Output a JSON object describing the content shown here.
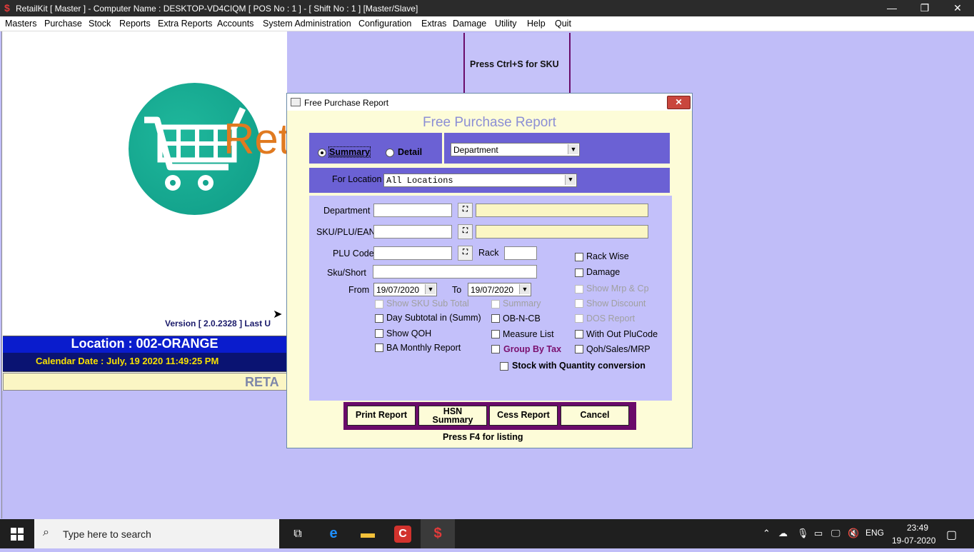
{
  "window": {
    "title": "RetailKit [ Master ] - Computer Name : DESKTOP-VD4CIQM [ POS No : 1 ] - [ Shift No : 1 ]  [Master/Slave]",
    "app_icon": "$",
    "minimize": "—",
    "restore": "❐",
    "close": "✕"
  },
  "menu": [
    "Masters",
    "Purchase",
    "Stock",
    "Reports",
    "Extra Reports",
    "Accounts",
    "System Administration",
    "Configuration",
    "Extras",
    "Damage",
    "Utility",
    "Help",
    "Quit"
  ],
  "background": {
    "logo_text": "Ret",
    "version": "Version [ 2.0.2328 ]  Last U",
    "location": "Location : 002-ORANGE",
    "calendar": "Calendar Date : July, 19 2020 11:49:25 PM",
    "retail_strip": "RETA",
    "sku_hint": "Press Ctrl+S for SKU"
  },
  "dialog": {
    "window_title": "Free Purchase Report",
    "close_label": "✕",
    "heading": "Free Purchase Report",
    "summary_label": "Summary",
    "detail_label": "Detail",
    "group_select": "Department",
    "for_location_label": "For Location",
    "location_select": "All Locations",
    "department_label": "Department",
    "sku_label": "SKU/PLU/EAN",
    "plu_label": "PLU Code",
    "rack_label": "Rack",
    "sku_short_label": "Sku/Short",
    "from_label": "From",
    "from_date": "19/07/2020",
    "to_label": "To",
    "to_date": "19/07/2020",
    "options_col1": [
      "Show SKU Sub Total",
      "Day Subtotal in (Summ)",
      "Show QOH",
      "BA Monthly Report"
    ],
    "options_col2": [
      "Summary",
      "OB-N-CB",
      "Measure List",
      "Group By Tax"
    ],
    "options_col3": [
      "Rack Wise",
      "Damage",
      "Show Mrp  & Cp",
      "Show Discount",
      "DOS Report",
      "With Out PluCode",
      "Qoh/Sales/MRP"
    ],
    "stock_conversion": "Stock with Quantity conversion",
    "buttons": {
      "print": "Print Report",
      "hsn1": "HSN",
      "hsn2": "Summary",
      "cess": "Cess Report",
      "cancel": "Cancel"
    },
    "footer": "Press F4 for listing",
    "binoc_icon": "🔍"
  },
  "taskbar": {
    "search_placeholder": "Type here to search",
    "language": "ENG",
    "time": "23:49",
    "date": "19-07-2020"
  },
  "colors": {
    "accent_purple": "#6b61d4",
    "lavender": "#c3c0fa",
    "dialog_bg": "#fdfcd8",
    "location_blue": "#0a1ccd"
  }
}
